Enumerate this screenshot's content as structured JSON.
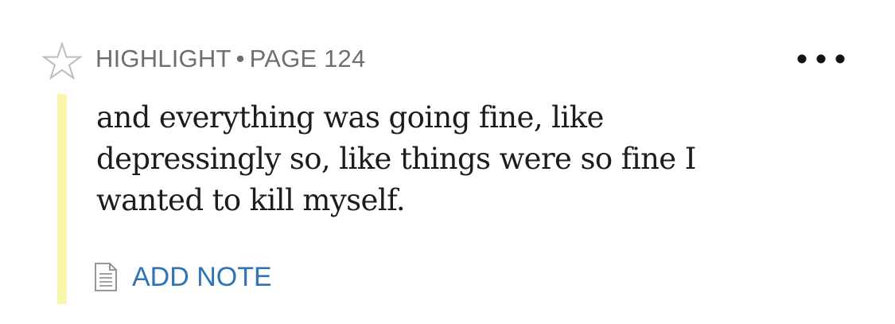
{
  "header": {
    "type_label": "HIGHLIGHT",
    "separator": "•",
    "location_label": "PAGE 124"
  },
  "icons": {
    "star": "star-outline-icon",
    "more": "more-horizontal-icon",
    "note": "note-document-icon"
  },
  "highlight": {
    "color": "#fbf6ad",
    "lines": [
      "and everything was going fine, like",
      "depressingly so, like things were so fine I",
      "wanted to kill myself."
    ]
  },
  "actions": {
    "add_note_label": "ADD NOTE",
    "link_color": "#2f74b5"
  }
}
